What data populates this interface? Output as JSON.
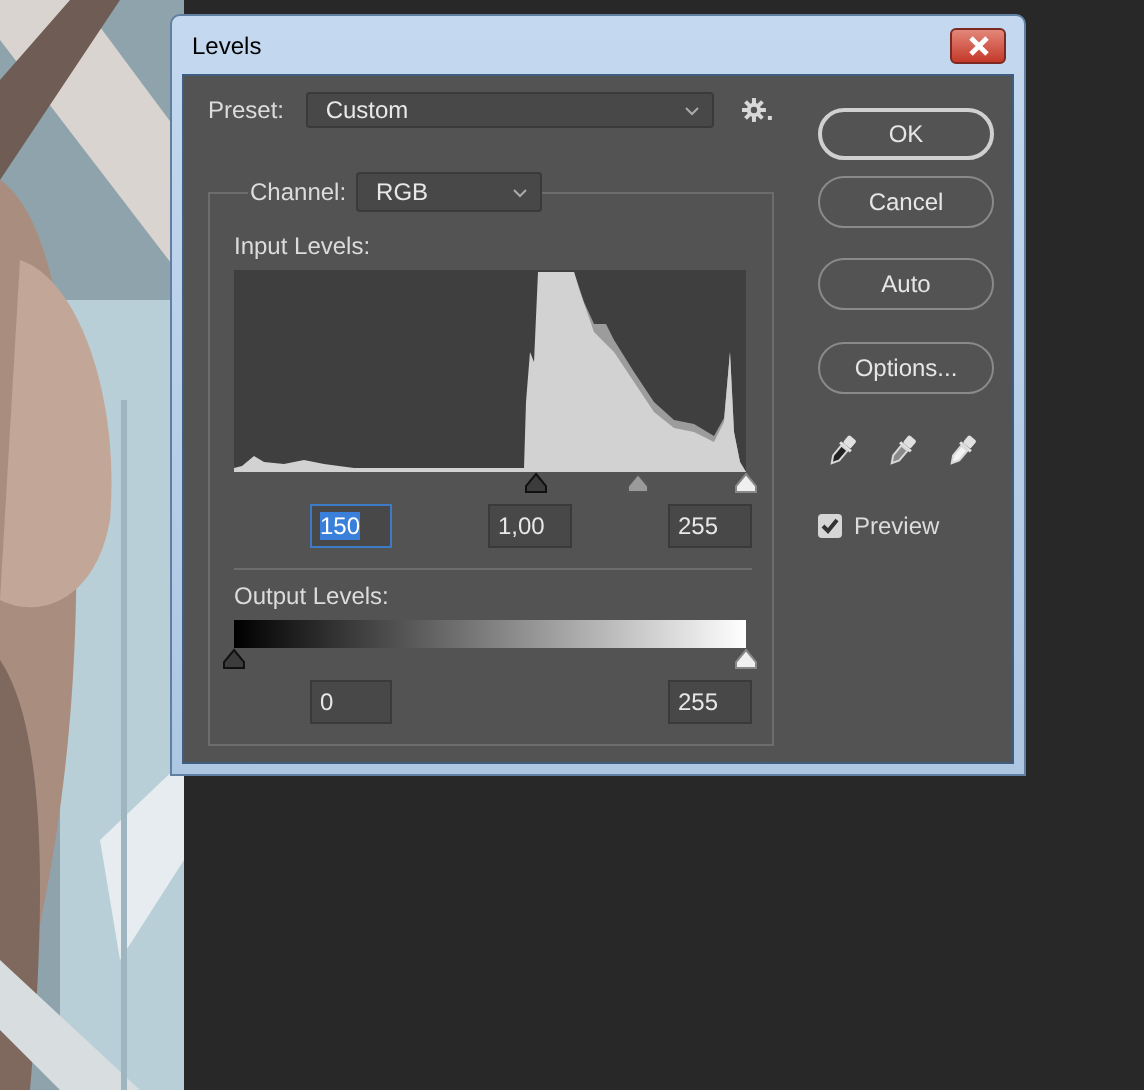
{
  "window": {
    "title": "Levels"
  },
  "preset": {
    "label": "Preset:",
    "value": "Custom"
  },
  "channel": {
    "label": "Channel:",
    "value": "RGB"
  },
  "input_levels": {
    "label": "Input Levels:",
    "handles": [
      {
        "kind": "black",
        "level": 0.588
      },
      {
        "kind": "gray",
        "level": 0.79
      },
      {
        "kind": "white",
        "level": 1
      }
    ],
    "fields": [
      {
        "value": "150",
        "selected": true
      },
      {
        "value": "1,00",
        "selected": false
      },
      {
        "value": "255",
        "selected": false
      }
    ]
  },
  "output_levels": {
    "label": "Output Levels:",
    "handles": [
      {
        "kind": "black",
        "level": 0
      },
      {
        "kind": "white",
        "level": 1
      }
    ],
    "fields": [
      {
        "value": "0",
        "selected": false
      },
      {
        "value": "255",
        "selected": false
      }
    ]
  },
  "buttons": [
    {
      "label": "OK",
      "default": true
    },
    {
      "label": "Cancel",
      "default": false
    },
    {
      "label": "Auto",
      "default": false
    },
    {
      "label": "Options...",
      "default": false
    }
  ],
  "eyedroppers": [
    {
      "kind": "black"
    },
    {
      "kind": "gray"
    },
    {
      "kind": "white"
    }
  ],
  "preview": {
    "label": "Preview",
    "checked": true
  }
}
